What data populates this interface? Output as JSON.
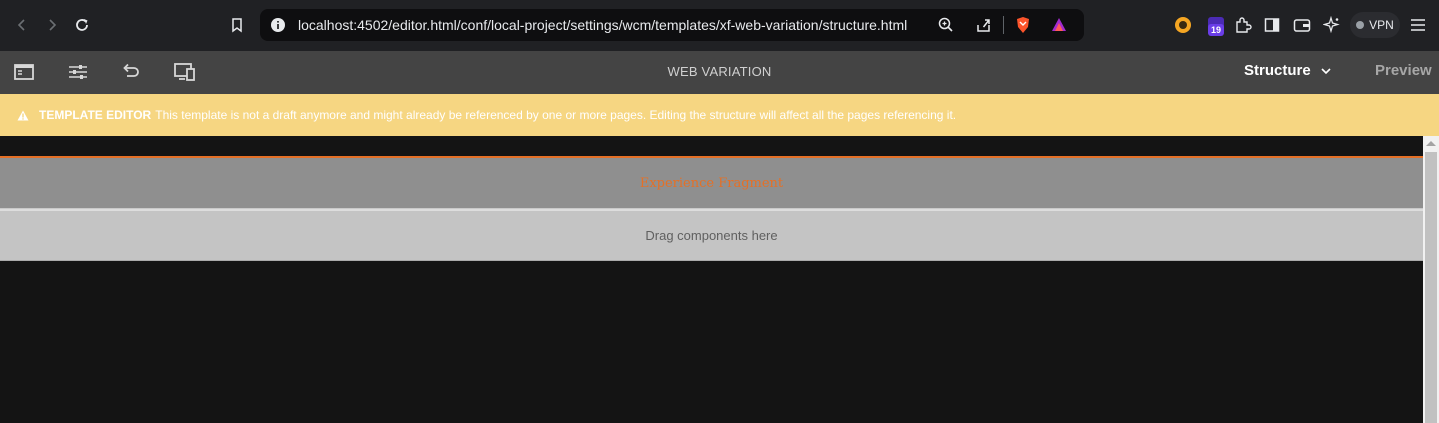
{
  "browser": {
    "url": "localhost:4502/editor.html/conf/local-project/settings/wcm/templates/xf-web-variation/structure.html",
    "extension_badge": "19",
    "vpn_label": "VPN"
  },
  "toolbar": {
    "page_name": "WEB VARIATION",
    "mode_label": "Structure",
    "preview_label": "Preview"
  },
  "alert": {
    "title": "TEMPLATE EDITOR",
    "message": "This template is not a draft anymore and might already be referenced by one or more pages. Editing the structure will affect all the pages referencing it."
  },
  "canvas": {
    "component_label": "Experience Fragment",
    "dropzone_label": "Drag components here"
  },
  "colors": {
    "alert_bg": "#f6d682",
    "accent_orange": "#e57026",
    "toolbar_bg": "#444444"
  }
}
